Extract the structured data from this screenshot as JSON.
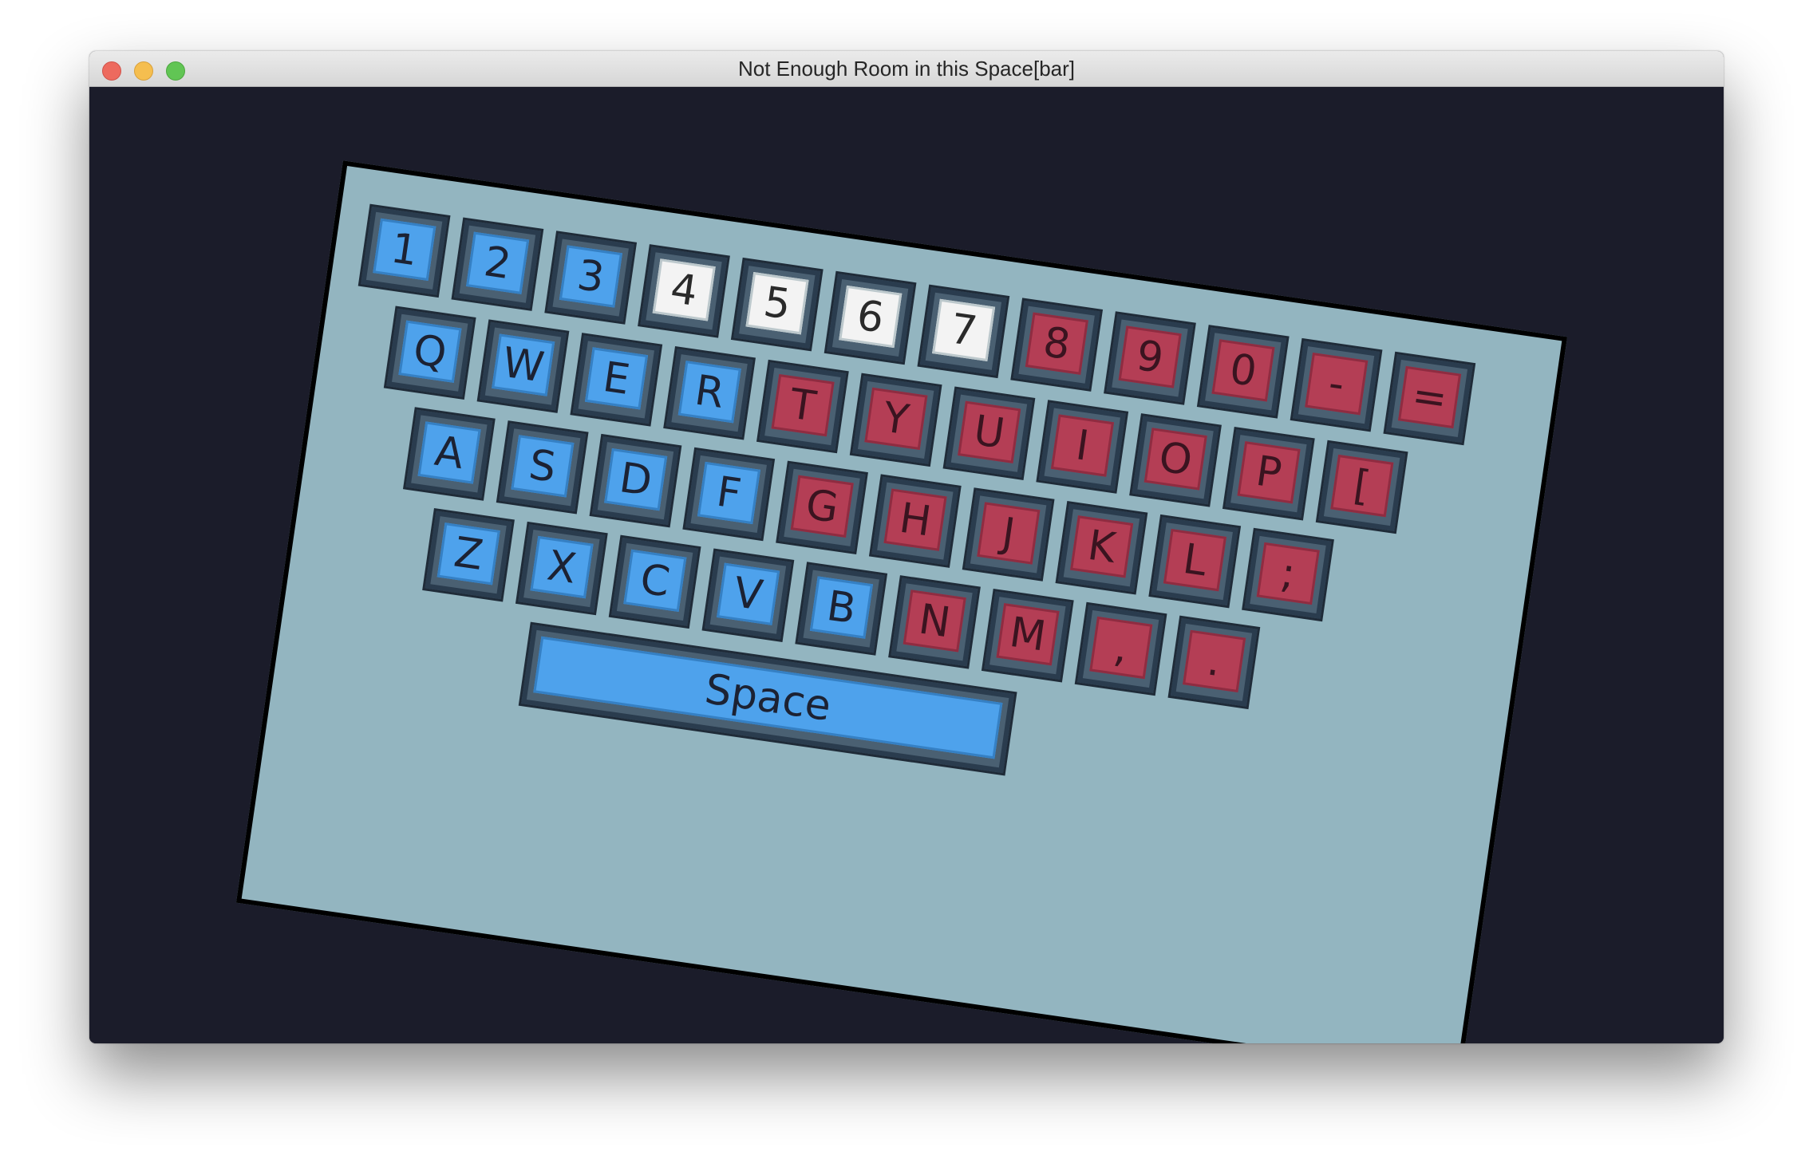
{
  "window": {
    "title": "Not Enough Room in this Space[bar]"
  },
  "colors": {
    "background": "#1b1c2a",
    "board": "#93b5c0",
    "key_blue": "#4ea2ec",
    "key_white": "#f3f3f3",
    "key_red": "#b43e55",
    "key_frame": "#4a6072"
  },
  "keyboard": {
    "rows": [
      {
        "keys": [
          {
            "label": "1",
            "color": "blue"
          },
          {
            "label": "2",
            "color": "blue"
          },
          {
            "label": "3",
            "color": "blue"
          },
          {
            "label": "4",
            "color": "white"
          },
          {
            "label": "5",
            "color": "white"
          },
          {
            "label": "6",
            "color": "white"
          },
          {
            "label": "7",
            "color": "white"
          },
          {
            "label": "8",
            "color": "red"
          },
          {
            "label": "9",
            "color": "red"
          },
          {
            "label": "0",
            "color": "red"
          },
          {
            "label": "-",
            "color": "red"
          },
          {
            "label": "=",
            "color": "red"
          }
        ]
      },
      {
        "keys": [
          {
            "label": "Q",
            "color": "blue"
          },
          {
            "label": "W",
            "color": "blue"
          },
          {
            "label": "E",
            "color": "blue"
          },
          {
            "label": "R",
            "color": "blue"
          },
          {
            "label": "T",
            "color": "red"
          },
          {
            "label": "Y",
            "color": "red"
          },
          {
            "label": "U",
            "color": "red"
          },
          {
            "label": "I",
            "color": "red"
          },
          {
            "label": "O",
            "color": "red"
          },
          {
            "label": "P",
            "color": "red"
          },
          {
            "label": "[",
            "color": "red"
          }
        ]
      },
      {
        "keys": [
          {
            "label": "A",
            "color": "blue"
          },
          {
            "label": "S",
            "color": "blue"
          },
          {
            "label": "D",
            "color": "blue"
          },
          {
            "label": "F",
            "color": "blue"
          },
          {
            "label": "G",
            "color": "red"
          },
          {
            "label": "H",
            "color": "red"
          },
          {
            "label": "J",
            "color": "red"
          },
          {
            "label": "K",
            "color": "red"
          },
          {
            "label": "L",
            "color": "red"
          },
          {
            "label": ";",
            "color": "red"
          }
        ]
      },
      {
        "keys": [
          {
            "label": "Z",
            "color": "blue"
          },
          {
            "label": "X",
            "color": "blue"
          },
          {
            "label": "C",
            "color": "blue"
          },
          {
            "label": "V",
            "color": "blue"
          },
          {
            "label": "B",
            "color": "blue"
          },
          {
            "label": "N",
            "color": "red"
          },
          {
            "label": "M",
            "color": "red"
          },
          {
            "label": ",",
            "color": "red"
          },
          {
            "label": ".",
            "color": "red"
          }
        ]
      }
    ],
    "space": {
      "label": "Space",
      "color": "blue"
    }
  }
}
